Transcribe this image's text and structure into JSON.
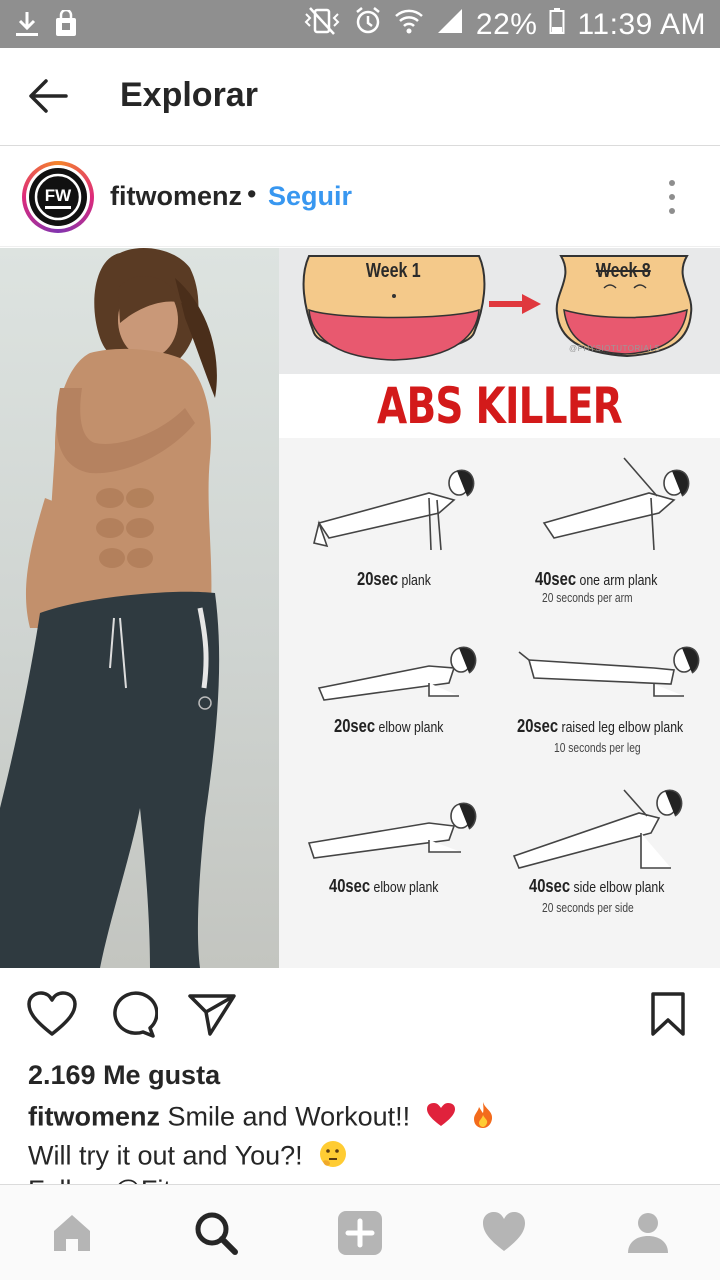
{
  "status_bar": {
    "battery": "22%",
    "time": "11:39 AM",
    "icons": [
      "download-icon",
      "bag-icon",
      "vibrate-icon",
      "alarm-icon",
      "wifi-icon",
      "signal-icon",
      "battery-icon"
    ]
  },
  "app_bar": {
    "title": "Explorar",
    "back_icon": "arrow-left-icon"
  },
  "post": {
    "username": "fitwomenz",
    "separator": "•",
    "follow_label": "Seguir",
    "avatar_text": "FW",
    "more_icon": "more-vertical-icon",
    "image": {
      "week_start": "Week 1",
      "week_end": "Week 8",
      "watermark": "@PHYSIOTUTORIALS",
      "title": "ABS KILLER",
      "exercises": [
        {
          "time": "20sec",
          "name": "plank",
          "note": ""
        },
        {
          "time": "40sec",
          "name": "one arm plank",
          "note": "20 seconds per arm"
        },
        {
          "time": "20sec",
          "name": "elbow plank",
          "note": ""
        },
        {
          "time": "20sec",
          "name": "raised leg elbow plank",
          "note": "10 seconds per leg"
        },
        {
          "time": "40sec",
          "name": "elbow plank",
          "note": ""
        },
        {
          "time": "40sec",
          "name": "side elbow plank",
          "note": "20 seconds per side"
        }
      ]
    },
    "likes": "2.169 Me gusta",
    "caption_user": "fitwomenz",
    "caption_text": "Smile and Workout!!",
    "caption_line2": "Will try it out and You?!",
    "caption_line3": "Follow @Fit"
  },
  "bottom_nav": [
    "home-icon",
    "search-icon",
    "add-icon",
    "heart-icon",
    "profile-icon"
  ],
  "colors": {
    "status_bar": "#8f8f8f",
    "link": "#3897f0",
    "abs_title": "#d31a1a",
    "story_ring_start": "#f58529",
    "story_ring_end": "#8134af"
  }
}
